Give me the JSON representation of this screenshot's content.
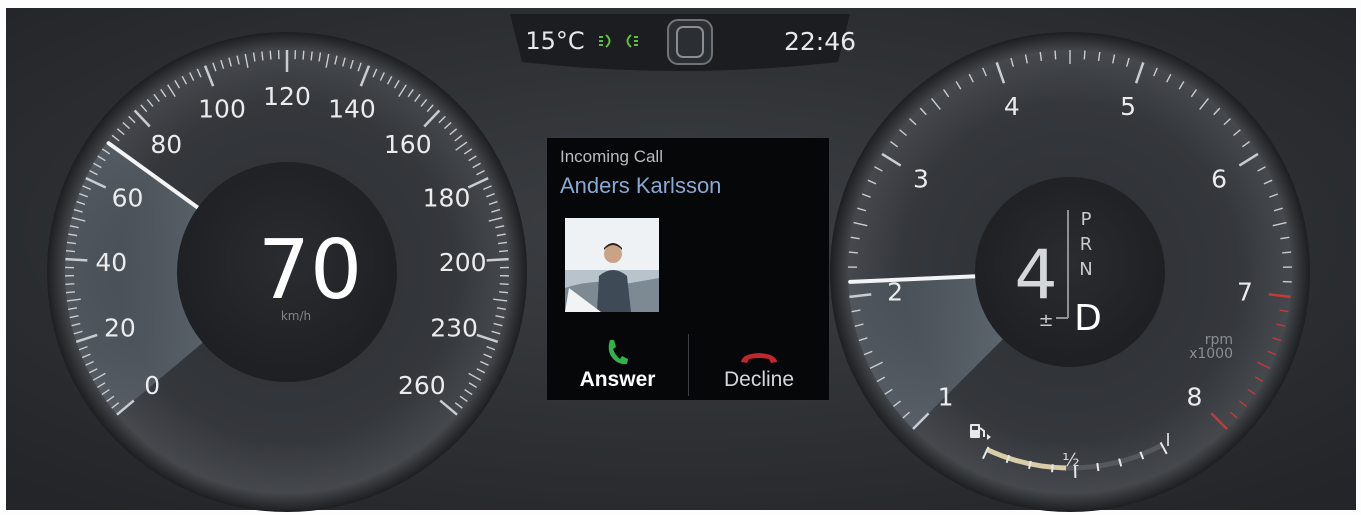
{
  "topbar": {
    "temperature": "15°C",
    "time": "22:46",
    "light_indicator_icon": "headlight-indicator-icon",
    "center_icon": "driver-support-icon",
    "indicator_color": "#5fbf3d"
  },
  "speedometer": {
    "speed": "70",
    "unit": "km/h",
    "ticks": [
      "0",
      "20",
      "40",
      "60",
      "80",
      "100",
      "120",
      "140",
      "160",
      "180",
      "200",
      "230",
      "260"
    ],
    "needle_value": 70
  },
  "call": {
    "title": "Incoming Call",
    "caller": "Anders Karlsson",
    "answer_label": "Answer",
    "decline_label": "Decline",
    "answer_color": "#2fb34a",
    "decline_color": "#c0272d"
  },
  "tachometer": {
    "ticks": [
      "1",
      "2",
      "3",
      "4",
      "5",
      "6",
      "7",
      "8"
    ],
    "needle_value": 2.1,
    "unit_line1": "rpm",
    "unit_line2": "x1000",
    "redline_color": "#c23a3a"
  },
  "gear": {
    "current": "4",
    "manual_mark": "±",
    "positions": [
      "P",
      "R",
      "N"
    ],
    "selected": "D"
  },
  "fuel": {
    "icon": "fuel-pump-icon",
    "half_label": "½",
    "full_label": "I",
    "level": 0.45
  }
}
